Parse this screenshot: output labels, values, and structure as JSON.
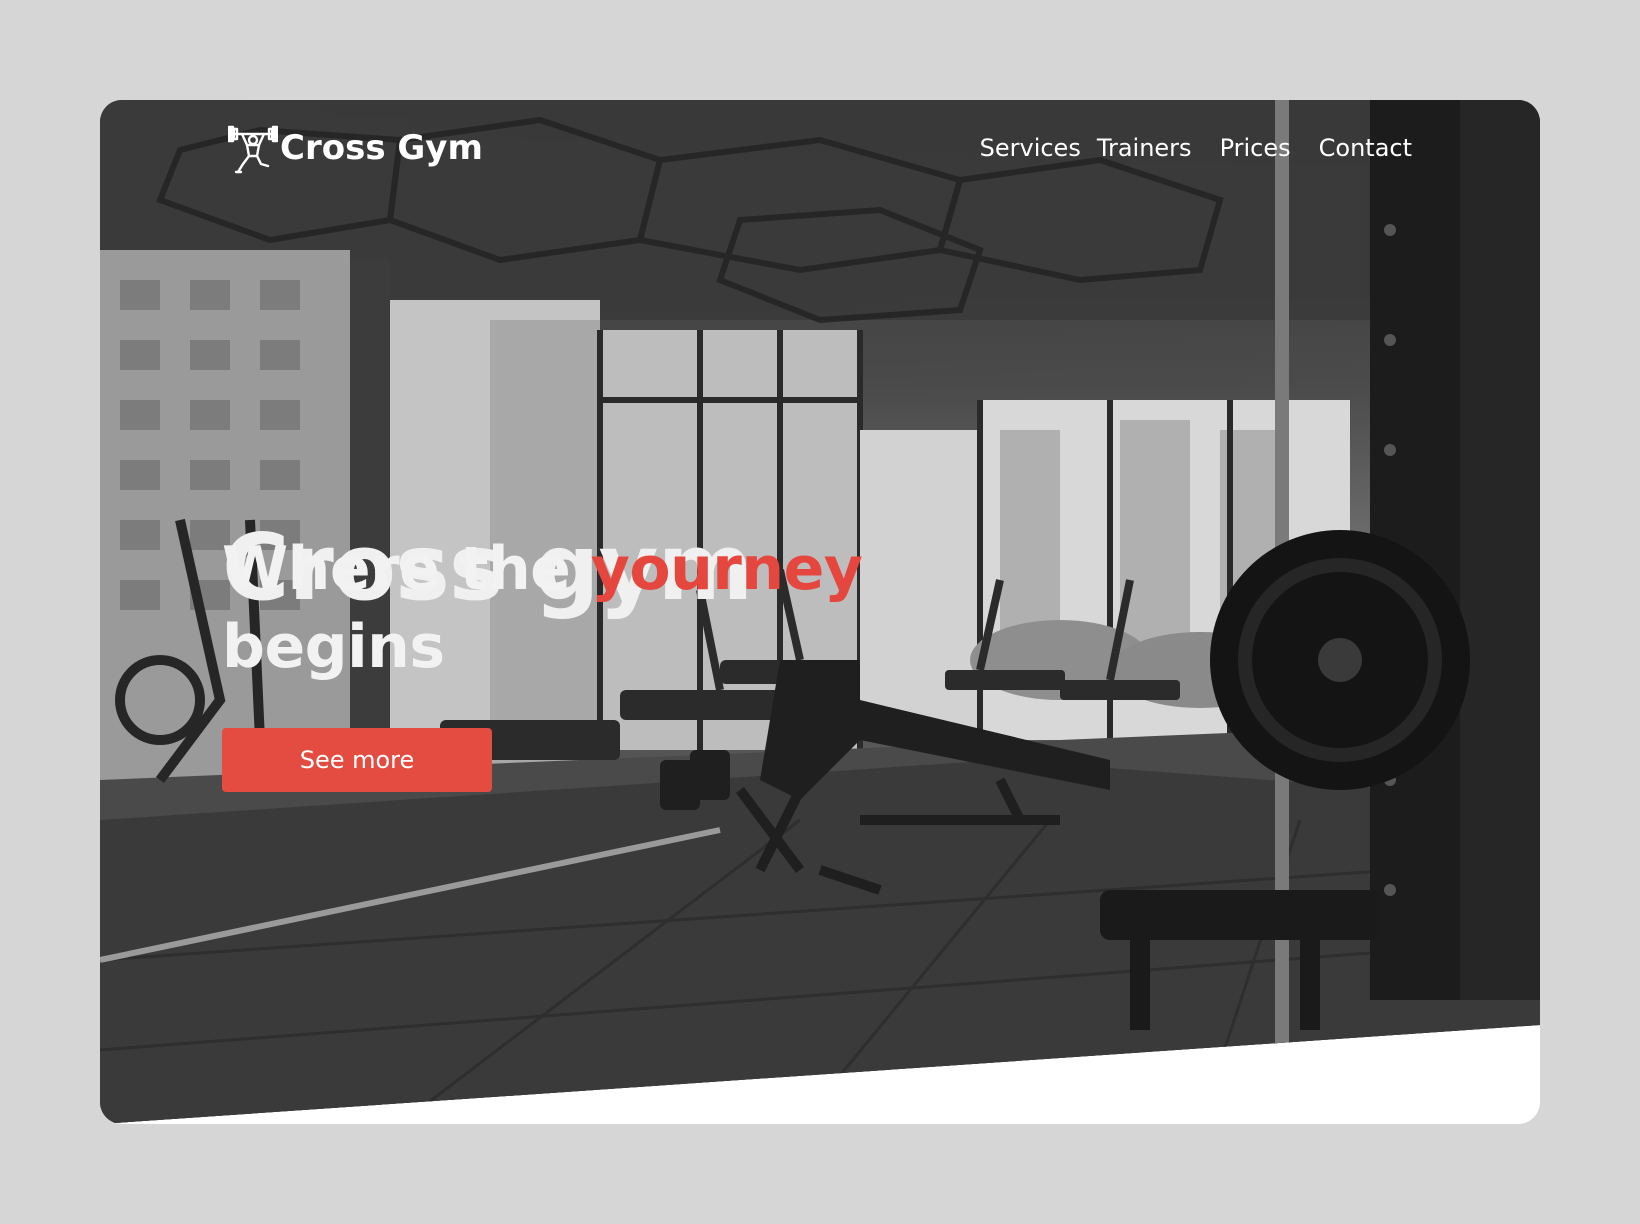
{
  "brand": {
    "name": "Cross Gym",
    "logo_icon": "weightlifter-icon"
  },
  "nav": {
    "items": [
      {
        "label": "Services"
      },
      {
        "label": "Trainers"
      },
      {
        "label": "Prices"
      },
      {
        "label": "Contact"
      }
    ]
  },
  "hero": {
    "title": "Cross gym",
    "tagline_prefix": "Where the ",
    "tagline_accent": "yourney",
    "tagline_suffix": " begins",
    "cta_label": "See more",
    "background": "gym-interior-photo"
  },
  "colors": {
    "accent": "#e44c42",
    "page_background": "#d6d6d6",
    "card_background": "#ffffff",
    "text_light": "#ffffff"
  }
}
